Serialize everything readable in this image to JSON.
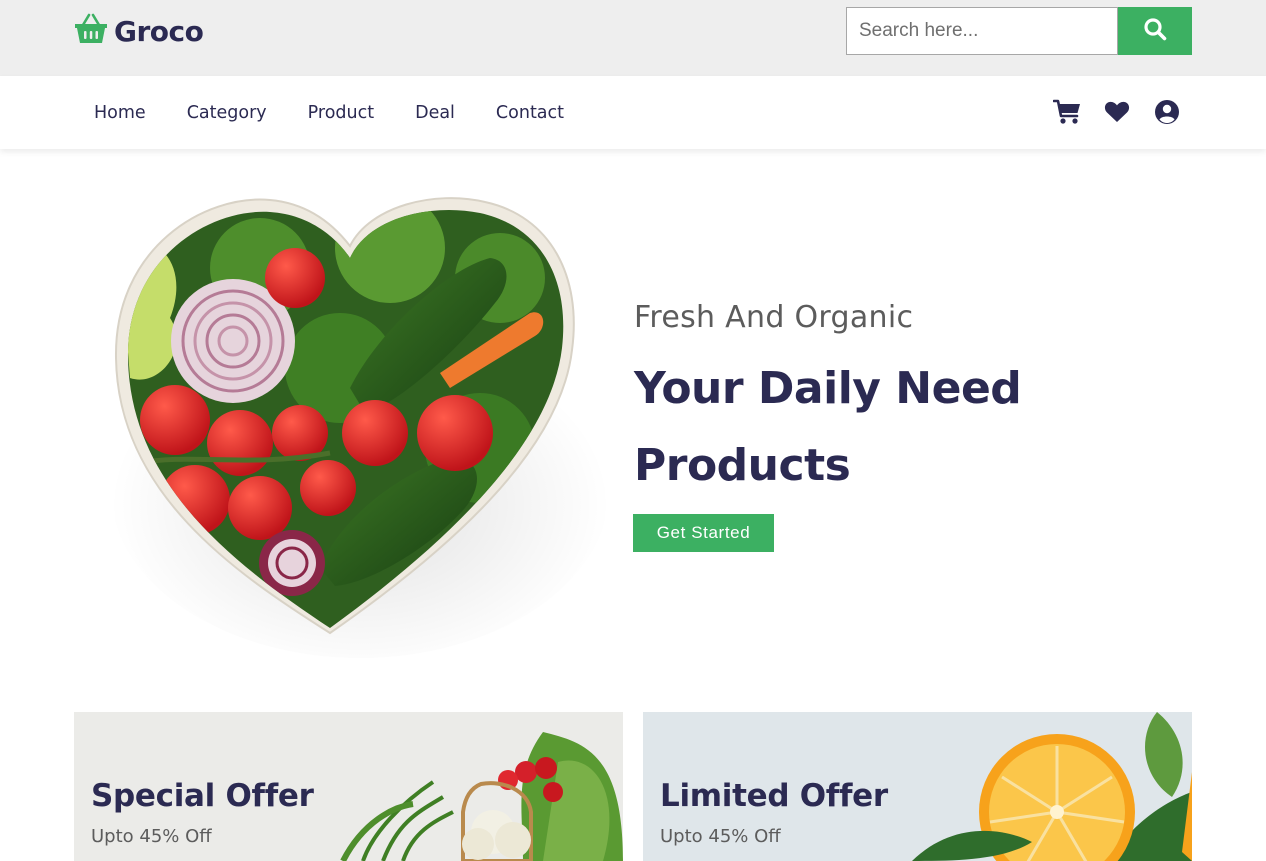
{
  "brand": {
    "name": "Groco",
    "accent_color": "#3cb062",
    "text_color": "#2b2a52",
    "logo_icon": "basket-icon"
  },
  "search": {
    "placeholder": "Search here...",
    "value": "",
    "button_icon": "search-icon"
  },
  "nav": {
    "links": [
      "Home",
      "Category",
      "Product",
      "Deal",
      "Contact"
    ],
    "icons": [
      "cart-icon",
      "heart-icon",
      "user-circle-icon"
    ]
  },
  "hero": {
    "subtitle": "Fresh And Organic",
    "title_line1": "Your Daily Need",
    "title_line2": "Products",
    "cta_label": "Get Started",
    "image": "heart-shaped-vegetable-bowl"
  },
  "offers": [
    {
      "title": "Special Offer",
      "subtitle": "Upto 45% Off",
      "image": "vegetables-basket"
    },
    {
      "title": "Limited Offer",
      "subtitle": "Upto 45% Off",
      "image": "orange-slice-and-leaves"
    }
  ]
}
